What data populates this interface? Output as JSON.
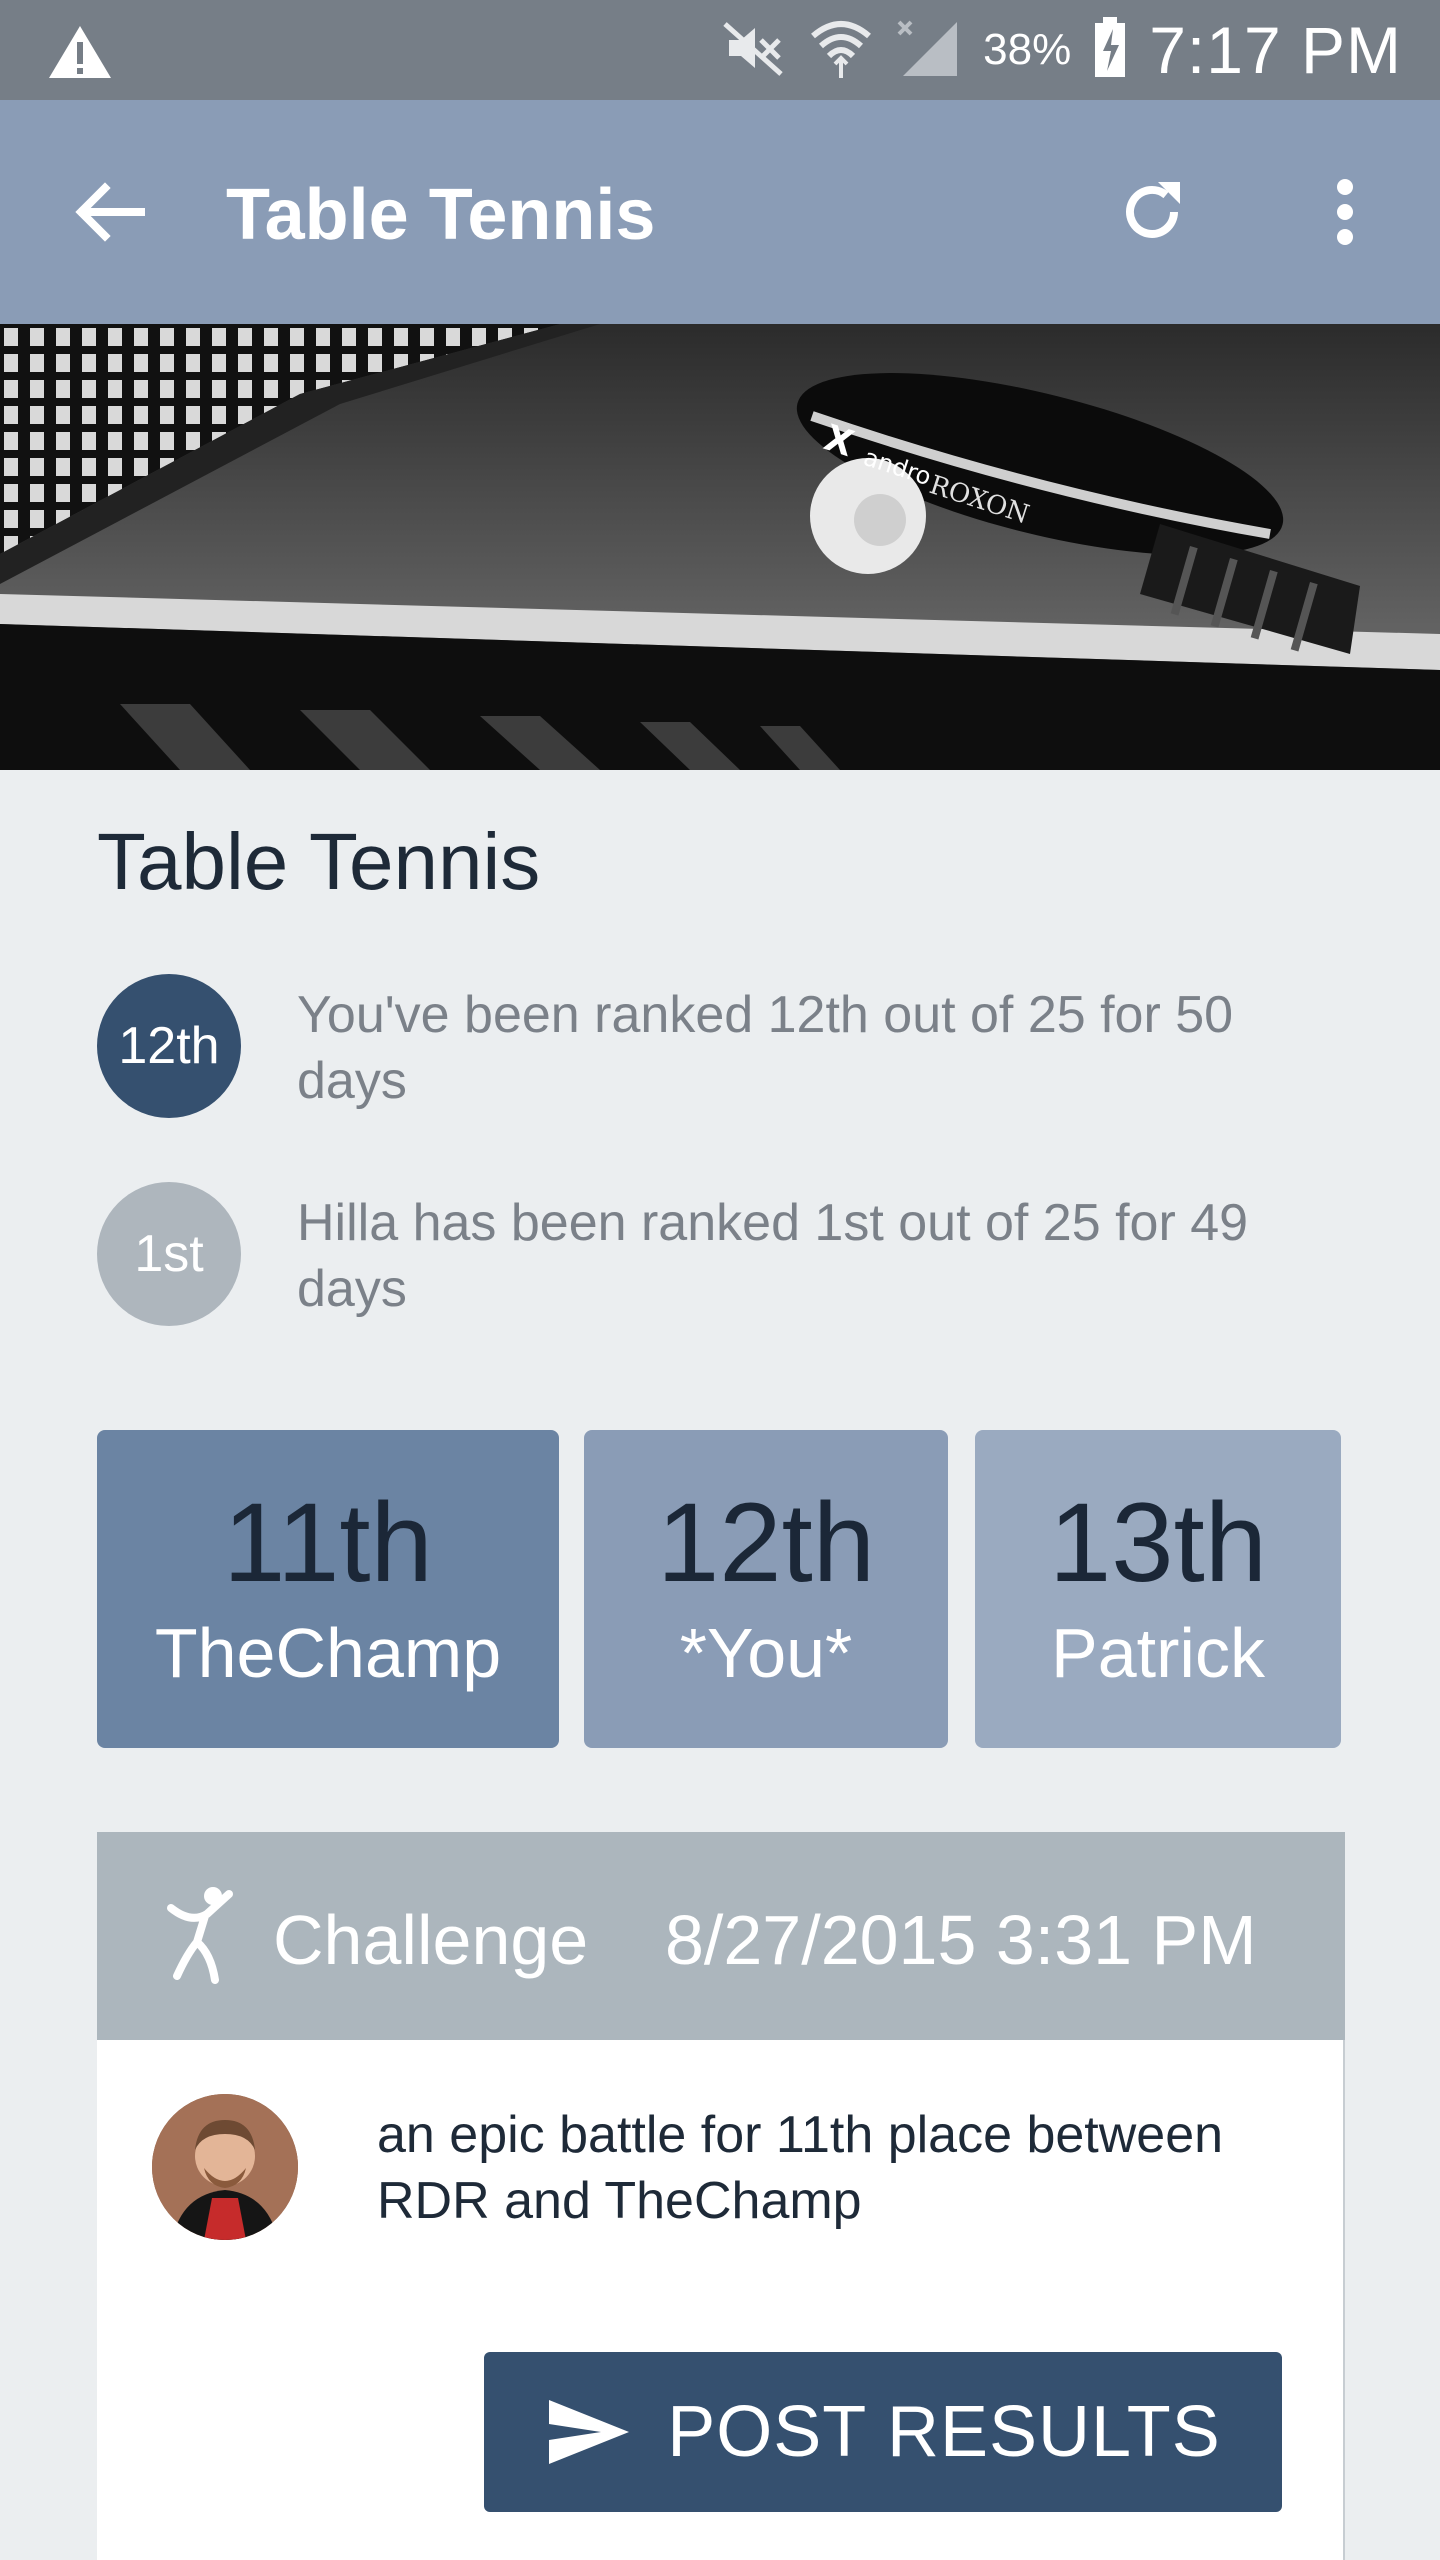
{
  "status_bar": {
    "battery_percent": "38%",
    "time": "7:17 PM",
    "icons": [
      "warning-icon",
      "mute-icon",
      "wifi-icon",
      "signal-icon",
      "battery-charging-icon"
    ]
  },
  "app_bar": {
    "title": "Table Tennis",
    "icons": [
      "back-arrow-icon",
      "refresh-icon",
      "more-vert-icon"
    ]
  },
  "hero_image": {
    "subject": "table tennis paddle and ball on table",
    "paddle_brand_text": "andro",
    "paddle_text": "ROXON",
    "paddle_letter": "X"
  },
  "main": {
    "title": "Table Tennis",
    "rankings": [
      {
        "badge": "12th",
        "text": "You've been ranked 12th out of 25 for 50 days"
      },
      {
        "badge": "1st",
        "text": "Hilla has been ranked 1st out of 25 for 49 days"
      }
    ],
    "neighbors": [
      {
        "place": "11th",
        "name": "TheChamp"
      },
      {
        "place": "12th",
        "name": "*You*"
      },
      {
        "place": "13th",
        "name": "Patrick"
      }
    ]
  },
  "challenge": {
    "label": "Challenge",
    "date": "8/27/2015 3:31 PM",
    "description": "an epic battle for 11th place between RDR and TheChamp",
    "button_label": "POST RESULTS",
    "icons": [
      "challenge-figure-icon",
      "send-icon"
    ]
  },
  "colors": {
    "app_bar": "#8a9cb6",
    "status_bar": "#767e87",
    "accent_dark": "#35506f",
    "card_1": "#6b84a3",
    "card_2": "#8a9cb6",
    "card_3": "#9aaac0",
    "challenge_header": "#acb6bd",
    "background": "#ebeef0"
  }
}
